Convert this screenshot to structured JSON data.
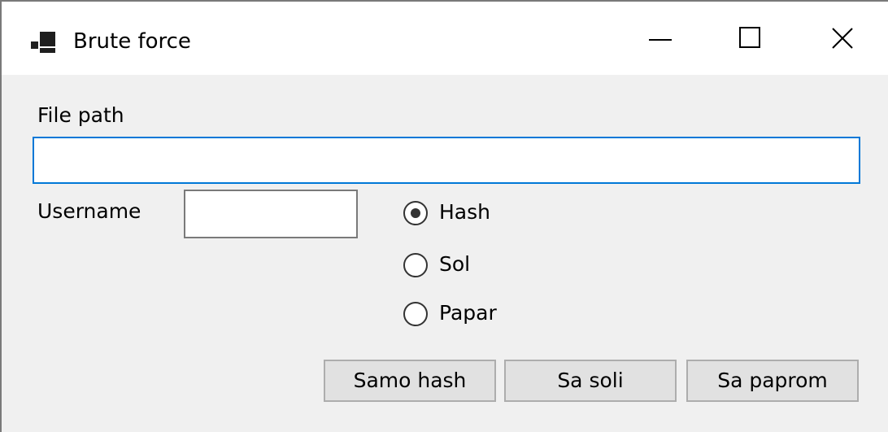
{
  "window": {
    "title": "Brute force",
    "controls": {
      "minimize": "minimize",
      "maximize": "maximize",
      "close": "close"
    }
  },
  "form": {
    "file_path_label": "File path",
    "file_path_value": "",
    "username_label": "Username",
    "username_value": "",
    "options": [
      {
        "label": "Hash",
        "checked": true
      },
      {
        "label": "Sol",
        "checked": false
      },
      {
        "label": "Papar",
        "checked": false
      }
    ]
  },
  "buttons": {
    "samo_hash": "Samo hash",
    "sa_soli": "Sa soli",
    "sa_paprom": "Sa paprom"
  },
  "colors": {
    "focus_border": "#0078d7",
    "window_bg": "#f0f0f0",
    "titlebar_bg": "#ffffff",
    "button_bg": "#e1e1e1"
  },
  "icons": {
    "app": "app-window-icon",
    "minimize": "minimize-icon",
    "maximize": "maximize-icon",
    "close": "close-icon"
  }
}
